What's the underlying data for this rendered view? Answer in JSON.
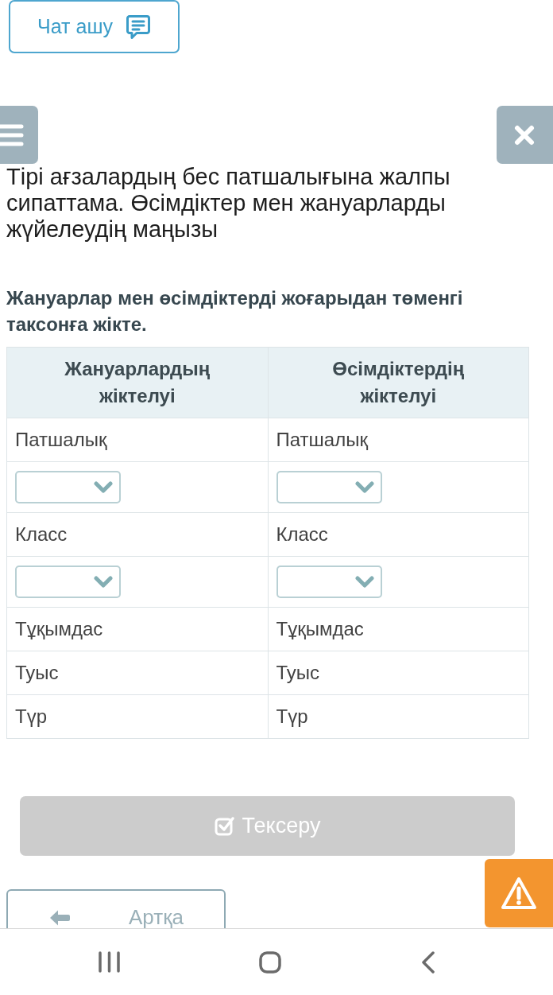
{
  "chat_button": {
    "label": "Чат ашу"
  },
  "lesson_title": "Тірі ағзалардың бес патшалығына жалпы сипаттама. Өсімдіктер мен жануарларды жүйелеудің маңызы",
  "task": {
    "prompt": "Жануарлар мен өсімдіктерді жоғарыдан төменгі таксонға жікте.",
    "table": {
      "columns": [
        "Жануарлардың жіктелуі",
        "Өсімдіктердің жіктелуі"
      ],
      "rows": [
        {
          "cells": [
            {
              "kind": "text",
              "text": "Патшалық"
            },
            {
              "kind": "text",
              "text": "Патшалық"
            }
          ]
        },
        {
          "cells": [
            {
              "kind": "select"
            },
            {
              "kind": "select"
            }
          ]
        },
        {
          "cells": [
            {
              "kind": "text",
              "text": "Класс"
            },
            {
              "kind": "text",
              "text": "Класс"
            }
          ]
        },
        {
          "cells": [
            {
              "kind": "select"
            },
            {
              "kind": "select"
            }
          ]
        },
        {
          "cells": [
            {
              "kind": "text",
              "text": "Тұқымдас"
            },
            {
              "kind": "text",
              "text": "Тұқымдас"
            }
          ]
        },
        {
          "cells": [
            {
              "kind": "text",
              "text": "Туыс"
            },
            {
              "kind": "text",
              "text": "Туыс"
            }
          ]
        },
        {
          "cells": [
            {
              "kind": "text",
              "text": "Түр"
            },
            {
              "kind": "text",
              "text": "Түр"
            }
          ]
        }
      ]
    }
  },
  "check_button": {
    "label": "Тексеру",
    "disabled": true
  },
  "back_button": {
    "label": "Артқа"
  }
}
